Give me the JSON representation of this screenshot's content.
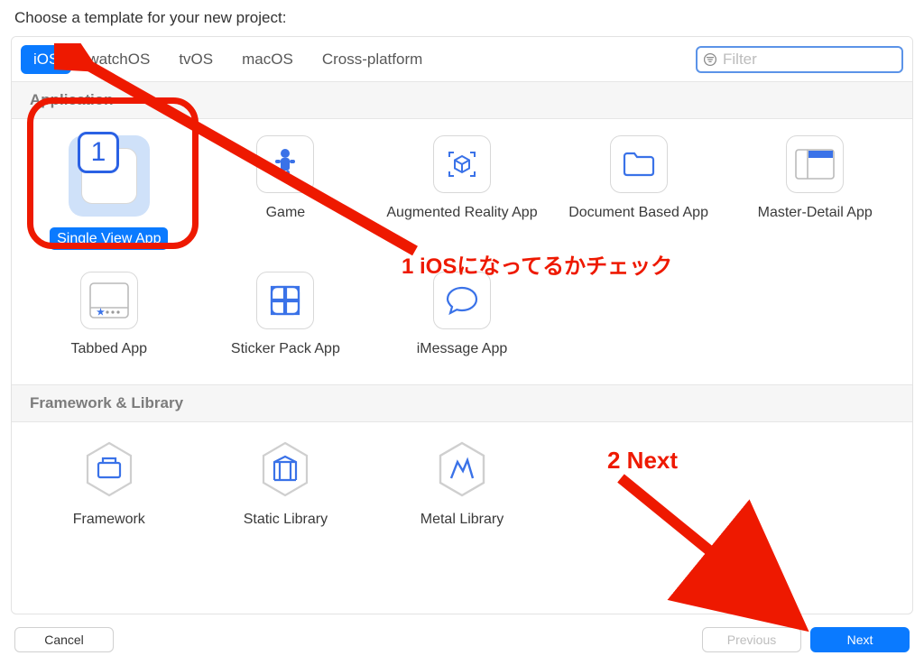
{
  "heading": "Choose a template for your new project:",
  "tabs": [
    "iOS",
    "watchOS",
    "tvOS",
    "macOS",
    "Cross-platform"
  ],
  "active_tab": 0,
  "filter": {
    "placeholder": "Filter",
    "value": ""
  },
  "sections": {
    "application": {
      "label": "Application",
      "items": [
        "Single View App",
        "Game",
        "Augmented Reality App",
        "Document Based App",
        "Master-Detail App",
        "Tabbed App",
        "Sticker Pack App",
        "iMessage App"
      ],
      "selected": 0
    },
    "framework": {
      "label": "Framework & Library",
      "items": [
        "Framework",
        "Static Library",
        "Metal Library"
      ]
    }
  },
  "footer": {
    "cancel": "Cancel",
    "previous": "Previous",
    "next": "Next"
  },
  "annotations": {
    "marker1": "1",
    "text1": "1 iOSになってるかチェック",
    "text2": "2 Next"
  }
}
